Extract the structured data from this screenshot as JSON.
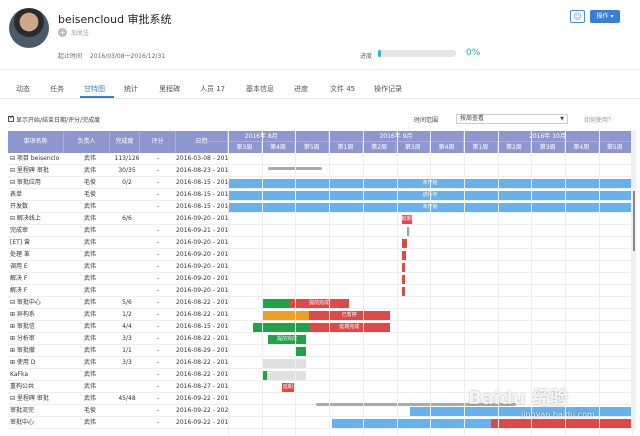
{
  "project": {
    "title": "beisencloud 审批系统",
    "follow_label": "加关注",
    "start_end_label": "起止时间",
    "date_range": "2016/03/08一2016/12/31",
    "progress_label": "进度",
    "progress_value": 0,
    "progress_text": "0%"
  },
  "actions": {
    "icon_name": "person-icon",
    "operate_label": "操作 ▾"
  },
  "tabs": [
    "动态",
    "任务",
    "甘特图",
    "统计",
    "里程碑",
    "人员 17",
    "基本信息",
    "进度",
    "文件 45",
    "操作记录"
  ],
  "active_tab": "甘特图",
  "toolbar": {
    "checkbox_label": "显示开始/结束日期/评分/完成度",
    "range_label": "时间范围",
    "range_value": "按周查看",
    "help_label": "如何使用？"
  },
  "table": {
    "headers": [
      "事项名称",
      "负责人",
      "完成度",
      "评分",
      "日期"
    ],
    "months": [
      "2016年 8月",
      "2016年 9月",
      "2016年 10月"
    ],
    "weeks": [
      "第3周",
      "第4周",
      "第5周",
      "第1周",
      "第2周",
      "第3周",
      "第4周",
      "第1周",
      "第2周",
      "第3周",
      "第4周",
      "第5周"
    ],
    "rows": [
      {
        "name": "⊟ 项目 beisenclo",
        "owner": "武伟",
        "done": "113/126",
        "score": "-",
        "date": "2016-03-08 - 2016"
      },
      {
        "name": "⊟ 里程碑 审批",
        "owner": "武伟",
        "done": "30/35",
        "score": "-",
        "date": "2016-08-23 - 2016"
      },
      {
        "name": "⊟ 审批应用",
        "owner": "毛俊",
        "done": "0/2",
        "score": "-",
        "date": "2016-08-15 - 2016"
      },
      {
        "name": "表单",
        "owner": "毛俊",
        "done": "",
        "score": "-",
        "date": "2016-08-15 - 2016"
      },
      {
        "name": "开发数",
        "owner": "武伟",
        "done": "",
        "score": "-",
        "date": "2016-08-15 - 2016"
      },
      {
        "name": "⊟ 解决线上",
        "owner": "武伟",
        "done": "6/6",
        "score": "",
        "date": "2016-09-20 - 2016"
      },
      {
        "name": "完成审",
        "owner": "武伟",
        "done": "",
        "score": "-",
        "date": "2016-09-21 - 2016"
      },
      {
        "name": "[ET] 曾",
        "owner": "武伟",
        "done": "",
        "score": "-",
        "date": "2016-09-20 - 2016"
      },
      {
        "name": "处理 革",
        "owner": "武伟",
        "done": "",
        "score": "-",
        "date": "2016-09-20 - 2016"
      },
      {
        "name": "调用 E",
        "owner": "武伟",
        "done": "",
        "score": "-",
        "date": "2016-09-20 - 2016"
      },
      {
        "name": "解决 F",
        "owner": "武伟",
        "done": "",
        "score": "-",
        "date": "2016-09-20 - 2016"
      },
      {
        "name": "解决 F",
        "owner": "武伟",
        "done": "",
        "score": "-",
        "date": "2016-09-20 - 2016"
      },
      {
        "name": "⊟ 审批中心",
        "owner": "武伟",
        "done": "5/6",
        "score": "-",
        "date": "2016-08-22 - 2016"
      },
      {
        "name": "⊞ 异构系",
        "owner": "武伟",
        "done": "1/2",
        "score": "-",
        "date": "2016-08-22 - 2016"
      },
      {
        "name": "⊞ 审批信",
        "owner": "武伟",
        "done": "4/4",
        "score": "-",
        "date": "2016-08-15 - 2016"
      },
      {
        "name": "⊞ 分析审",
        "owner": "武伟",
        "done": "3/3",
        "score": "-",
        "date": "2016-08-22 - 2016"
      },
      {
        "name": "⊞ 审批撤",
        "owner": "武伟",
        "done": "1/1",
        "score": "-",
        "date": "2016-08-29 - 2016"
      },
      {
        "name": "⊞ 使用 D",
        "owner": "武伟",
        "done": "3/3",
        "score": "-",
        "date": "2016-08-22 - 2016"
      },
      {
        "name": "KaFka",
        "owner": "武伟",
        "done": "",
        "score": "-",
        "date": "2016-08-22 - 2016"
      },
      {
        "name": "重构公共",
        "owner": "武伟",
        "done": "",
        "score": "-",
        "date": "2016-08-27 - 2016"
      },
      {
        "name": "⊟ 里程碑 审批",
        "owner": "武伟",
        "done": "45/48",
        "score": "-",
        "date": "2016-09-22 - 2016"
      },
      {
        "name": "审批流完",
        "owner": "毛俊",
        "done": "",
        "score": "-",
        "date": "2016-09-22 - 2020"
      },
      {
        "name": "审批中心",
        "owner": "武伟",
        "done": "",
        "score": "-",
        "date": "2016-09-22 - 2016"
      }
    ]
  },
  "bars": [
    {
      "row": 2,
      "start": 0,
      "end": 12,
      "color": "#66b2ee",
      "split": 12,
      "color2": "#e04848",
      "label": "未开始"
    },
    {
      "row": 3,
      "start": 0,
      "end": 12,
      "color": "#66b2ee",
      "label": "进行中"
    },
    {
      "row": 4,
      "start": 0,
      "end": 12,
      "color": "#66b2ee",
      "label": "未开始"
    },
    {
      "row": 5,
      "start": 5.15,
      "end": 5.45,
      "color": "#e04848",
      "label": "延期"
    },
    {
      "row": 6,
      "start": 5.3,
      "end": 5.38,
      "color": "#66b2ee",
      "label": ""
    },
    {
      "row": 7,
      "start": 5.15,
      "end": 5.3,
      "color": "#e04848",
      "label": ""
    },
    {
      "row": 8,
      "start": 5.15,
      "end": 5.28,
      "color": "#e04848",
      "label": ""
    },
    {
      "row": 9,
      "start": 5.15,
      "end": 5.25,
      "color": "#e04848",
      "label": ""
    },
    {
      "row": 10,
      "start": 5.15,
      "end": 5.25,
      "color": "#e04848",
      "label": ""
    },
    {
      "row": 11,
      "start": 5.15,
      "end": 5.25,
      "color": "#e04848",
      "label": ""
    },
    {
      "row": 12,
      "start": 1.0,
      "end": 3.6,
      "color": "#1fa24a",
      "label": "提前完成",
      "split": 1.8,
      "color2": "#e04848"
    },
    {
      "row": 13,
      "start": 1.0,
      "end": 4.8,
      "color": "#f0a020",
      "label": "已暂停",
      "split": 2.4,
      "color2": "#e04848"
    },
    {
      "row": 14,
      "start": 0.75,
      "end": 4.8,
      "color": "#1fa24a",
      "label": "延期完成",
      "split": 2.4,
      "color2": "#e04848"
    },
    {
      "row": 15,
      "start": 1.2,
      "end": 2.3,
      "color": "#1fa24a",
      "label": "提前完成",
      "split": 2.3,
      "color2": "#e04848"
    },
    {
      "row": 16,
      "start": 2.0,
      "end": 2.3,
      "color": "#1fa24a",
      "label": "",
      "split": 2.3,
      "color2": "#e04848"
    },
    {
      "row": 17,
      "start": 1.0,
      "end": 2.3,
      "color": "#e0e0e0",
      "label": "",
      "split": 1.1,
      "color2": "#e0e0e0"
    },
    {
      "row": 18,
      "start": 1.0,
      "end": 2.3,
      "color": "#1fa24a",
      "label": "",
      "split": 1.15,
      "color2": "#e0e0e0"
    },
    {
      "row": 19,
      "start": 1.6,
      "end": 1.95,
      "color": "#e04848",
      "label": "延期"
    },
    {
      "row": 21,
      "start": 5.4,
      "end": 12,
      "color": "#66b2ee",
      "label": ""
    },
    {
      "row": 22,
      "start": 3.1,
      "end": 12,
      "color": "#66b2ee",
      "label": "",
      "split": 7.8,
      "color2": "#e04848"
    }
  ],
  "watermark": {
    "text": "Baidu 经验",
    "sub": "jingyan.baidu.com"
  }
}
